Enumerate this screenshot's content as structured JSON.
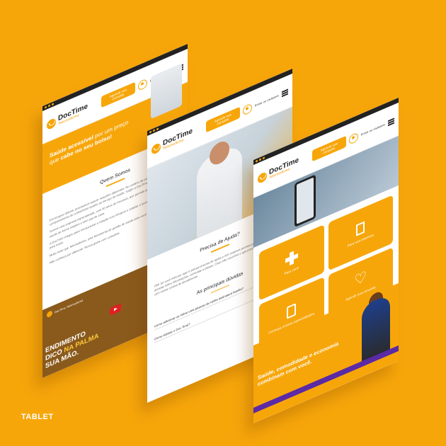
{
  "brand": {
    "name": "DocTime",
    "tagline": "Telemedicina"
  },
  "nav": {
    "cta_label": "Agende sua consulta",
    "login_label": "Entrar ou cadastrar"
  },
  "screen1": {
    "slogan_prefix": "Saúde acessível",
    "slogan_mid": " por um preço que ",
    "slogan_emph": "cabe no seu bolso!",
    "section_title": "Quem Somos",
    "paragraphs": [
      "Em tempos difíceis, precisamos buscar soluções diferentes. No cenário de pandemia, e da mudança no comportamento do consumidor quanto ao serviço de saúde, surgiu a DocTime.",
      "Somos uma empresa especializada, com 40 anos de mercado, que permite que você cuide da sua saúde de forma simples e sem sair de casa.",
      "A DocTime chegou para revolucionar a relação com médicos e ampliar o acesso à saúde de qualidade para todos.",
      "Muito mais que Telemedicina, uma ferramenta de gestão de saúde para você e sua família.",
      "Não conheça por diferente. Nunca gaste com consultas."
    ],
    "video_channel": "DocTime Telemedicina",
    "video_text_a": "ENDIMENTO",
    "video_text_b": "DICO",
    "video_text_c": "NA PALMA",
    "video_text_d": "SUA MÃO."
  },
  "screen2": {
    "section_title": "Precisa de Ajuda?",
    "paragraph": "Olá! Se você está por aqui é porque precisa de ajuda e nós estamos prontos para te ajudar. Tire suas dúvidas sobre informações, consultas e planos. Caso não encontre o que precisa, entre em contato com nossa central de atendimento.",
    "faq_title": "As principais dúvidas",
    "faq": [
      "Como adicionar ou retirar uma pessoa da minha assinatura família?",
      "Como assinar o Doc Time?"
    ]
  },
  "screen3": {
    "tiles": [
      {
        "label": "Para você",
        "icon": "plus-icon"
      },
      {
        "label": "Para sua empresa",
        "icon": "building-icon"
      },
      {
        "label": "Conheça nossas especialidades",
        "icon": "clipboard-icon"
      },
      {
        "label": "Agende sua consulta",
        "icon": "heart-plus-icon"
      }
    ],
    "banner_text": "Saúde, comodidade e economia combinam com você."
  },
  "footer_label": "TABLET",
  "colors": {
    "background": "#f7a60a",
    "accent": "#f7a60a",
    "purple": "#5b2aa5"
  }
}
